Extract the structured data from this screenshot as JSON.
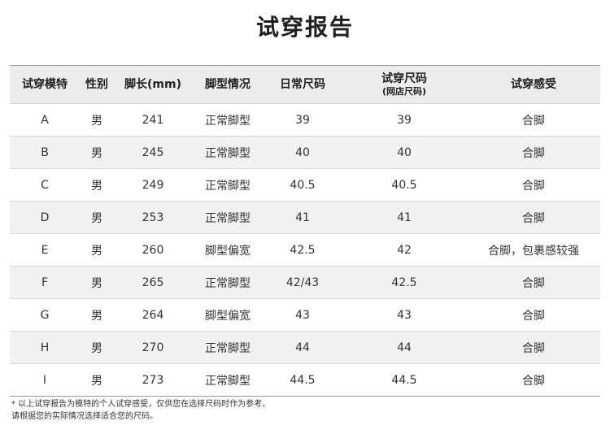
{
  "title": "试穿报告",
  "headers": {
    "model": "试穿模特",
    "gender": "性别",
    "foot_length": "脚长(mm)",
    "foot_type": "脚型情况",
    "daily_size": "日常尺码",
    "trial_size": "试穿尺码",
    "trial_size_sub": "(网店尺码)",
    "feeling": "试穿感受"
  },
  "rows": [
    {
      "model": "A",
      "gender": "男",
      "foot_length": "241",
      "foot_type": "正常脚型",
      "daily_size": "39",
      "trial_size": "39",
      "feeling": "合脚"
    },
    {
      "model": "B",
      "gender": "男",
      "foot_length": "245",
      "foot_type": "正常脚型",
      "daily_size": "40",
      "trial_size": "40",
      "feeling": "合脚"
    },
    {
      "model": "C",
      "gender": "男",
      "foot_length": "249",
      "foot_type": "正常脚型",
      "daily_size": "40.5",
      "trial_size": "40.5",
      "feeling": "合脚"
    },
    {
      "model": "D",
      "gender": "男",
      "foot_length": "253",
      "foot_type": "正常脚型",
      "daily_size": "41",
      "trial_size": "41",
      "feeling": "合脚"
    },
    {
      "model": "E",
      "gender": "男",
      "foot_length": "260",
      "foot_type": "脚型偏宽",
      "daily_size": "42.5",
      "trial_size": "42",
      "feeling": "合脚，包裹感较强"
    },
    {
      "model": "F",
      "gender": "男",
      "foot_length": "265",
      "foot_type": "正常脚型",
      "daily_size": "42/43",
      "trial_size": "42.5",
      "feeling": "合脚"
    },
    {
      "model": "G",
      "gender": "男",
      "foot_length": "264",
      "foot_type": "脚型偏宽",
      "daily_size": "43",
      "trial_size": "43",
      "feeling": "合脚"
    },
    {
      "model": "H",
      "gender": "男",
      "foot_length": "270",
      "foot_type": "正常脚型",
      "daily_size": "44",
      "trial_size": "44",
      "feeling": "合脚"
    },
    {
      "model": "I",
      "gender": "男",
      "foot_length": "273",
      "foot_type": "正常脚型",
      "daily_size": "44.5",
      "trial_size": "44.5",
      "feeling": "合脚"
    }
  ],
  "notes": {
    "line1": "* 以上试穿报告为模特的个人试穿感受，仅供您在选择尺码时作为参考。",
    "line2": "请根据您的实际情况选择适合您的尺码。"
  }
}
